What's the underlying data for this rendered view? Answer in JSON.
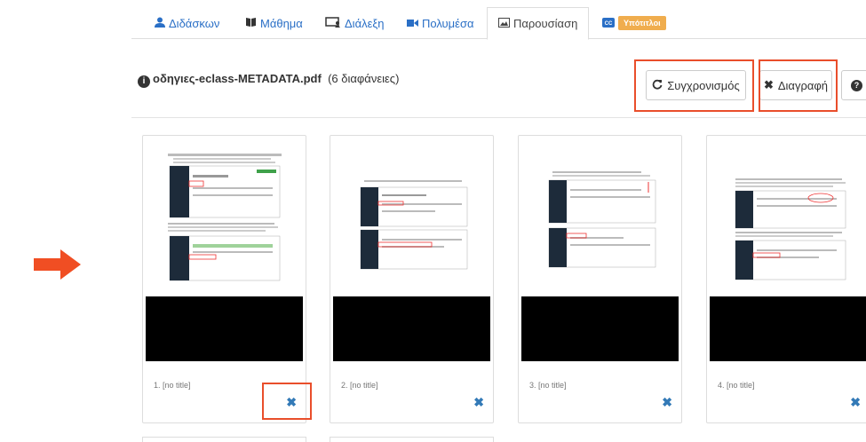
{
  "tabs": [
    {
      "label": "Διδάσκων",
      "icon": "user-icon"
    },
    {
      "label": "Μάθημα",
      "icon": "book-icon"
    },
    {
      "label": "Διάλεξη",
      "icon": "lecture-icon"
    },
    {
      "label": "Πολυμέσα",
      "icon": "video-icon"
    },
    {
      "label": "Παρουσίαση",
      "icon": "image-icon",
      "active": true
    },
    {
      "label": "Υπότιτλοι",
      "icon": "cc-icon",
      "badge": true
    }
  ],
  "file": {
    "name": "οδηγιες-eclass-METADATA.pdf",
    "count": "(6 διαφάνειες)"
  },
  "buttons": {
    "sync": "Συγχρονισμός",
    "delete": "Διαγραφή"
  },
  "slides": [
    {
      "caption": "1. [no title]"
    },
    {
      "caption": "2. [no title]"
    },
    {
      "caption": "3. [no title]"
    },
    {
      "caption": "4. [no title]"
    }
  ],
  "colors": {
    "accent": "#2a6fc6",
    "highlight": "#e94e2b",
    "arrow": "#f04e23",
    "badge": "#f0ad4e"
  }
}
